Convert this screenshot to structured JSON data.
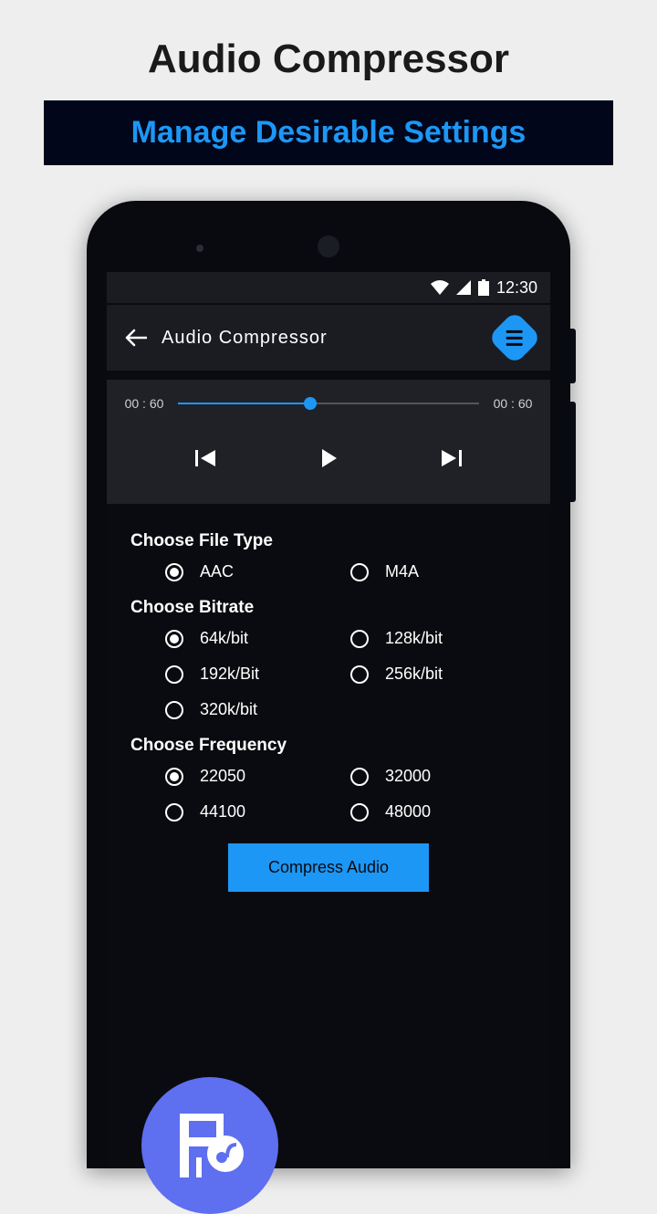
{
  "page": {
    "title": "Audio Compressor",
    "banner": "Manage Desirable Settings"
  },
  "status_bar": {
    "time": "12:30"
  },
  "app_bar": {
    "title": "Audio  Compressor"
  },
  "player": {
    "time_start": "00 : 60",
    "time_end": "00 : 60",
    "progress_percent": 44
  },
  "settings": {
    "file_type": {
      "label": "Choose File Type",
      "options": [
        "AAC",
        "M4A"
      ],
      "selected": "AAC"
    },
    "bitrate": {
      "label": "Choose Bitrate",
      "options": [
        "64k/bit",
        "128k/bit",
        "192k/Bit",
        "256k/bit",
        "320k/bit"
      ],
      "selected": "64k/bit"
    },
    "frequency": {
      "label": "Choose Frequency",
      "options": [
        "22050",
        "32000",
        "44100",
        "48000"
      ],
      "selected": "22050"
    }
  },
  "compress_button": "Compress Audio"
}
